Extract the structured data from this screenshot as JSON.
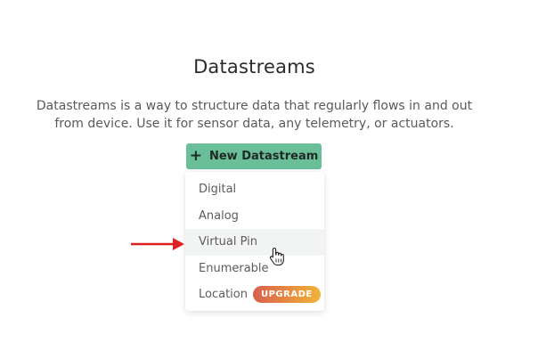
{
  "header": {
    "title": "Datastreams",
    "description": "Datastreams is a way to structure data that regularly flows in and out from device. Use it for sensor data, any telemetry, or actuators."
  },
  "new_button": {
    "icon": "plus-icon",
    "label": "New Datastream",
    "color": "#6bbf98"
  },
  "dropdown": {
    "items": [
      {
        "label": "Digital"
      },
      {
        "label": "Analog"
      },
      {
        "label": "Virtual Pin"
      },
      {
        "label": "Enumerable"
      },
      {
        "label": "Location",
        "badge": "UPGRADE"
      }
    ]
  },
  "annotation": {
    "arrow_color": "#e02020",
    "pointer": "hand-cursor-icon"
  }
}
